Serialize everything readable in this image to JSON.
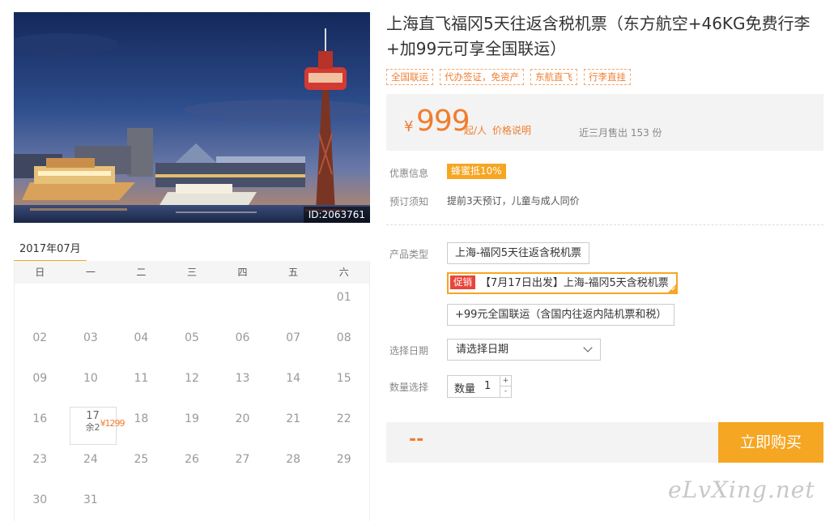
{
  "photo": {
    "id_label": "ID:2063761"
  },
  "calendar": {
    "month_tab": "2017年07月",
    "weekdays": [
      "日",
      "一",
      "二",
      "三",
      "四",
      "五",
      "六"
    ],
    "leading_blanks": 6,
    "days": [
      "01",
      "02",
      "03",
      "04",
      "05",
      "06",
      "07",
      "08",
      "09",
      "10",
      "11",
      "12",
      "13",
      "14",
      "15",
      "16",
      "17",
      "18",
      "19",
      "20",
      "21",
      "22",
      "23",
      "24",
      "25",
      "26",
      "27",
      "28",
      "29",
      "30",
      "31"
    ],
    "active_day": {
      "day": "17",
      "price": "¥1299",
      "remain": "余2"
    }
  },
  "product": {
    "title": "上海直飞福冈5天往返含税机票（东方航空+46KG免费行李+加99元可享全国联运）",
    "tags": [
      "全国联运",
      "代办签证，免资产",
      "东航直飞",
      "行李直挂"
    ],
    "price": {
      "currency": "¥",
      "amount": "999",
      "unit": "起/人",
      "note": "价格说明",
      "sold": "近三月售出 153 份"
    },
    "discount": {
      "label": "优惠信息",
      "badge": "蜂蜜抵10%"
    },
    "booking": {
      "label": "预订须知",
      "text": "提前3天预订，儿童与成人同价"
    },
    "type_label": "产品类型",
    "options": [
      {
        "text": "上海-福冈5天往返含税机票",
        "promo": "",
        "selected": false
      },
      {
        "text": "【7月17日出发】上海-福冈5天含税机票",
        "promo": "促销",
        "selected": true
      },
      {
        "text": "+99元全国联运（含国内往返内陆机票和税）",
        "promo": "",
        "selected": false
      }
    ],
    "date": {
      "label": "选择日期",
      "placeholder": "请选择日期"
    },
    "quantity": {
      "label": "数量选择",
      "inner_label": "数量",
      "value": "1",
      "plus": "+",
      "minus": "-"
    },
    "total": "--",
    "buy_label": "立即购买"
  },
  "watermark": "eLvXing.net",
  "colors": {
    "accent": "#f5a623",
    "price": "#f07d2e",
    "promo": "#e8453c"
  }
}
